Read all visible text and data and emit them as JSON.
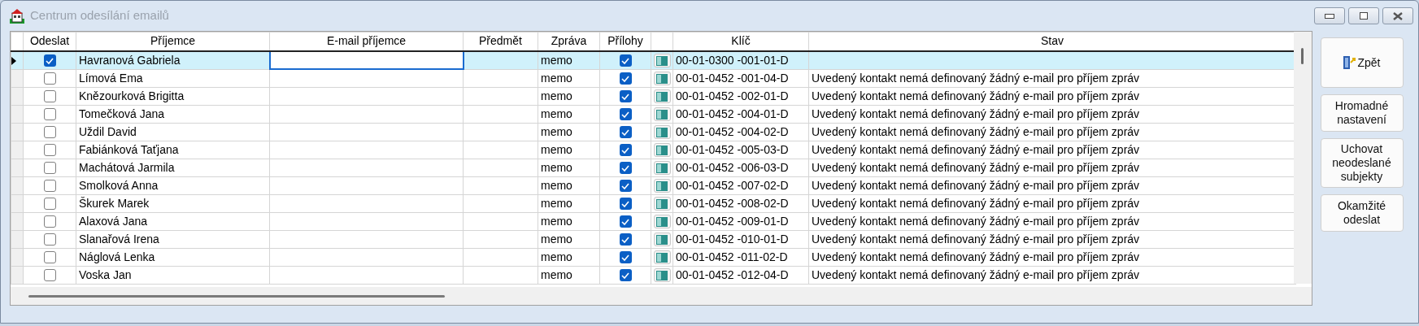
{
  "window": {
    "title": "Centrum odesílání emailů"
  },
  "table": {
    "columns": [
      "Odeslat",
      "Příjemce",
      "E-mail příjemce",
      "Předmět",
      "Zpráva",
      "Přílohy",
      "Klíč",
      "Stav"
    ],
    "rows": [
      {
        "selected": true,
        "send": true,
        "recipient": "Havranová Gabriela",
        "message": "memo",
        "attachments": true,
        "key": "00-01-0300 -001-01-D"
      },
      {
        "selected": false,
        "send": false,
        "recipient": "Límová Ema",
        "message": "memo",
        "attachments": true,
        "key": "00-01-0452 -001-04-D",
        "status": "Uvedený kontakt nemá definovaný žádný e-mail pro příjem zpráv"
      },
      {
        "selected": false,
        "send": false,
        "recipient": "Knězourková Brigitta",
        "message": "memo",
        "attachments": true,
        "key": "00-01-0452 -002-01-D",
        "status": "Uvedený kontakt nemá definovaný žádný e-mail pro příjem zpráv"
      },
      {
        "selected": false,
        "send": false,
        "recipient": "Tomečková Jana",
        "message": "memo",
        "attachments": true,
        "key": "00-01-0452 -004-01-D",
        "status": "Uvedený kontakt nemá definovaný žádný e-mail pro příjem zpráv"
      },
      {
        "selected": false,
        "send": false,
        "recipient": "Uždil David",
        "message": "memo",
        "attachments": true,
        "key": "00-01-0452 -004-02-D",
        "status": "Uvedený kontakt nemá definovaný žádný e-mail pro příjem zpráv"
      },
      {
        "selected": false,
        "send": false,
        "recipient": "Fabiánková Taťjana",
        "message": "memo",
        "attachments": true,
        "key": "00-01-0452 -005-03-D",
        "status": "Uvedený kontakt nemá definovaný žádný e-mail pro příjem zpráv"
      },
      {
        "selected": false,
        "send": false,
        "recipient": "Machátová Jarmila",
        "message": "memo",
        "attachments": true,
        "key": "00-01-0452 -006-03-D",
        "status": "Uvedený kontakt nemá definovaný žádný e-mail pro příjem zpráv"
      },
      {
        "selected": false,
        "send": false,
        "recipient": "Smolková Anna",
        "message": "memo",
        "attachments": true,
        "key": "00-01-0452 -007-02-D",
        "status": "Uvedený kontakt nemá definovaný žádný e-mail pro příjem zpráv"
      },
      {
        "selected": false,
        "send": false,
        "recipient": "Škurek Marek",
        "message": "memo",
        "attachments": true,
        "key": "00-01-0452 -008-02-D",
        "status": "Uvedený kontakt nemá definovaný žádný e-mail pro příjem zpráv"
      },
      {
        "selected": false,
        "send": false,
        "recipient": "Alaxová Jana",
        "message": "memo",
        "attachments": true,
        "key": "00-01-0452 -009-01-D",
        "status": "Uvedený kontakt nemá definovaný žádný e-mail pro příjem zpráv"
      },
      {
        "selected": false,
        "send": false,
        "recipient": "Slanařová Irena",
        "message": "memo",
        "attachments": true,
        "key": "00-01-0452 -010-01-D",
        "status": "Uvedený kontakt nemá definovaný žádný e-mail pro příjem zpráv"
      },
      {
        "selected": false,
        "send": false,
        "recipient": "Náglová Lenka",
        "message": "memo",
        "attachments": true,
        "key": "00-01-0452 -011-02-D",
        "status": "Uvedený kontakt nemá definovaný žádný e-mail pro příjem zpráv"
      },
      {
        "selected": false,
        "send": false,
        "recipient": "Voska Jan",
        "message": "memo",
        "attachments": true,
        "key": "00-01-0452 -012-04-D",
        "status": "Uvedený kontakt nemá definovaný žádný e-mail pro příjem zpráv"
      }
    ]
  },
  "buttons": [
    {
      "label": "Zpět",
      "kind": "icon"
    },
    {
      "label": "Hromadné nastavení",
      "kind": "text"
    },
    {
      "label": "Uchovat neodeslané subjekty",
      "kind": "text"
    },
    {
      "label": "Okamžité odeslat",
      "kind": "text"
    }
  ]
}
